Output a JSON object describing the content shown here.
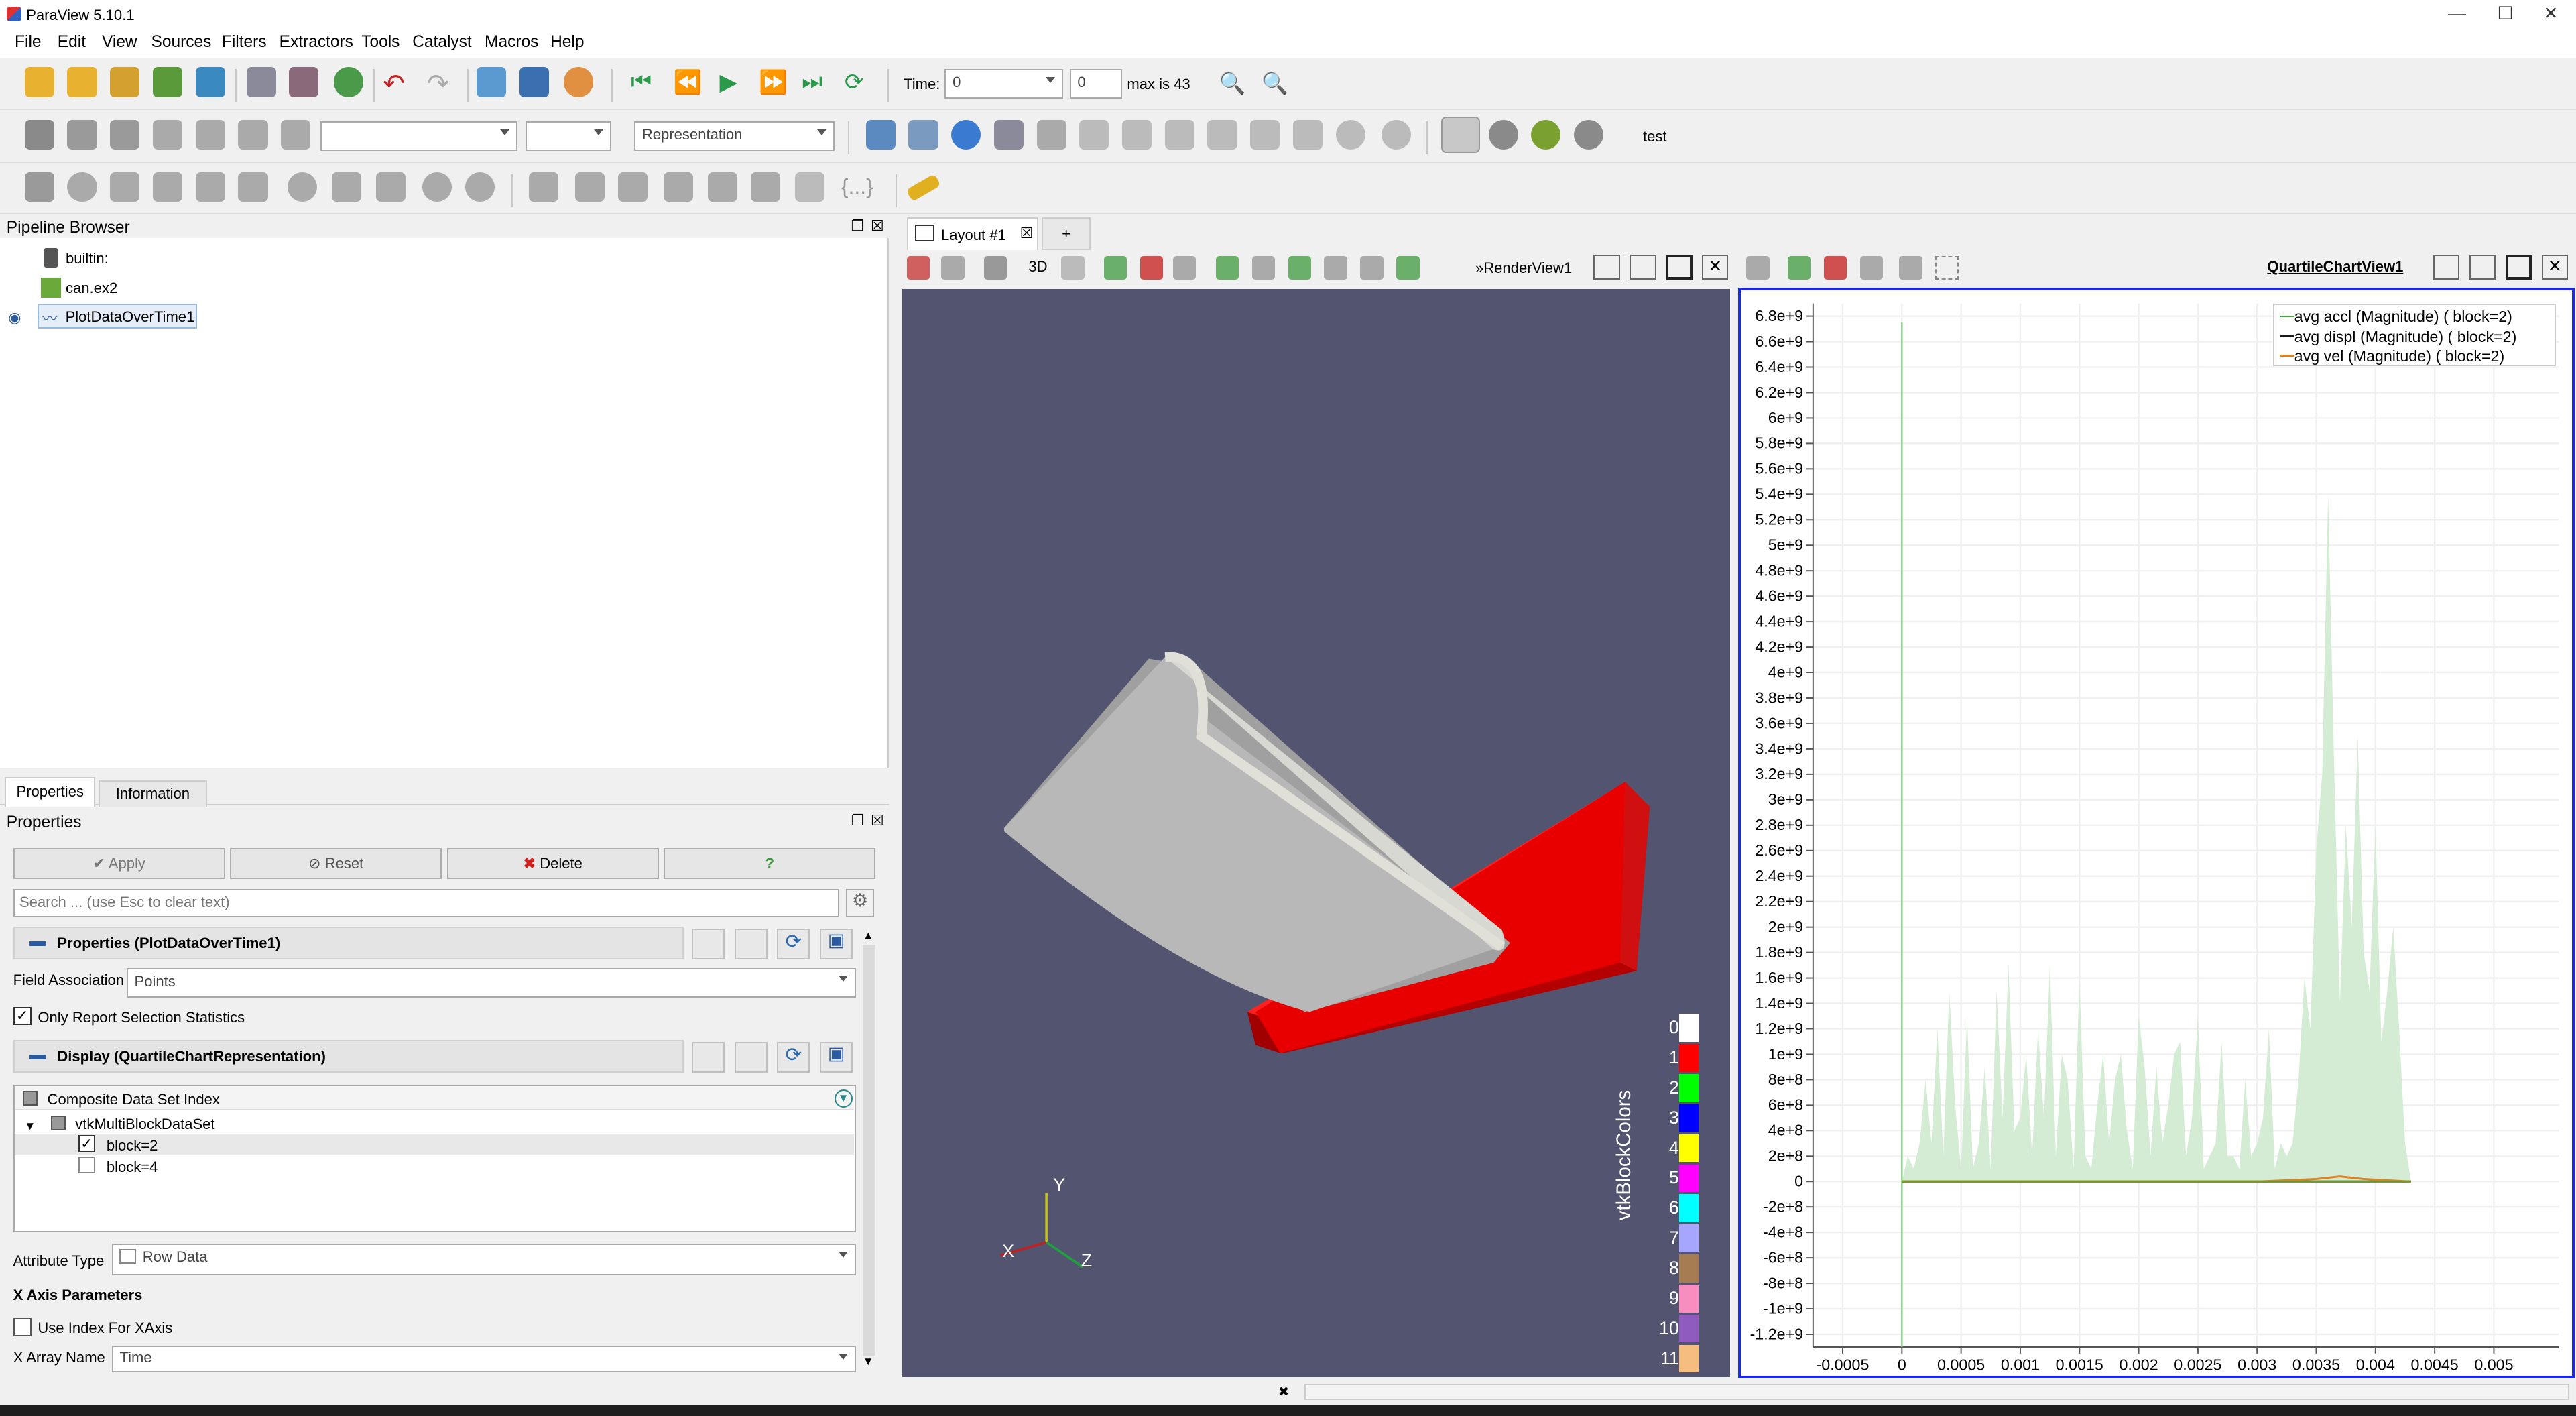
{
  "window": {
    "title": "ParaView 5.10.1",
    "minimize": "—",
    "maximize": "☐",
    "close": "✕"
  },
  "menu": [
    "File",
    "Edit",
    "View",
    "Sources",
    "Filters",
    "Extractors",
    "Tools",
    "Catalyst",
    "Macros",
    "Help"
  ],
  "time_toolbar": {
    "time_label": "Time:",
    "time_value": "0",
    "step_value": "0",
    "max_label": "max is 43"
  },
  "toolbar2": {
    "representation": "Representation",
    "camera_text": "test"
  },
  "pipeline": {
    "title": "Pipeline Browser",
    "items": [
      {
        "label": "builtin:",
        "icon": "server-icon"
      },
      {
        "label": "can.ex2",
        "icon": "dataset-icon"
      },
      {
        "label": "PlotDataOverTime1",
        "icon": "line-chart-icon"
      }
    ]
  },
  "tabs": {
    "properties": "Properties",
    "information": "Information"
  },
  "properties": {
    "title": "Properties",
    "apply": "Apply",
    "reset": "Reset",
    "delete": "Delete",
    "help": "?",
    "search_placeholder": "Search ... (use Esc to clear text)",
    "section1": "Properties (PlotDataOverTime1)",
    "field_assoc_label": "Field Association",
    "field_assoc_value": "Points",
    "only_stats_label": "Only Report Selection Statistics",
    "section2": "Display (QuartileChartRepresentation)",
    "tree_header": "Composite Data Set Index",
    "tree_root": "vtkMultiBlockDataSet",
    "blocks": [
      {
        "label": "block=2",
        "checked": true
      },
      {
        "label": "block=4",
        "checked": false
      }
    ],
    "attr_type_label": "Attribute Type",
    "attr_type_value": "Row Data",
    "x_axis_params": "X Axis Parameters",
    "use_index_label": "Use Index For XAxis",
    "x_array_label": "X Array Name",
    "x_array_value": "Time"
  },
  "layout": {
    "tab_label": "Layout #1",
    "add_tab": "+"
  },
  "render_view": {
    "label": "RenderView1",
    "btn_3d": "3D",
    "legend_title": "vtkBlockColors",
    "legend": [
      {
        "label": "0",
        "color": "#ffffff"
      },
      {
        "label": "1",
        "color": "#ff0000"
      },
      {
        "label": "2",
        "color": "#00ff00"
      },
      {
        "label": "3",
        "color": "#0000ff"
      },
      {
        "label": "4",
        "color": "#ffff00"
      },
      {
        "label": "5",
        "color": "#ff00ff"
      },
      {
        "label": "6",
        "color": "#00ffff"
      },
      {
        "label": "7",
        "color": "#a6a6ff"
      },
      {
        "label": "8",
        "color": "#a67c52"
      },
      {
        "label": "9",
        "color": "#f78ebf"
      },
      {
        "label": "10",
        "color": "#8f5bbf"
      },
      {
        "label": "11",
        "color": "#f5be7f"
      }
    ],
    "axes": {
      "x": "X",
      "y": "Y",
      "z": "Z"
    }
  },
  "chart_view": {
    "label": "QuartileChartView1"
  },
  "chart_data": {
    "type": "area",
    "x_ticks": [
      "-0.0005",
      "0",
      "0.0005",
      "0.001",
      "0.0015",
      "0.002",
      "0.0025",
      "0.003",
      "0.0035",
      "0.004",
      "0.0045",
      "0.005"
    ],
    "y_ticks": [
      "6.8e+9",
      "6.6e+9",
      "6.4e+9",
      "6.2e+9",
      "6e+9",
      "5.8e+9",
      "5.6e+9",
      "5.4e+9",
      "5.2e+9",
      "5e+9",
      "4.8e+9",
      "4.6e+9",
      "4.4e+9",
      "4.2e+9",
      "4e+9",
      "3.8e+9",
      "3.6e+9",
      "3.4e+9",
      "3.2e+9",
      "3e+9",
      "2.8e+9",
      "2.6e+9",
      "2.4e+9",
      "2.2e+9",
      "2e+9",
      "1.8e+9",
      "1.6e+9",
      "1.4e+9",
      "1.2e+9",
      "1e+9",
      "8e+8",
      "6e+8",
      "4e+8",
      "2e+8",
      "0",
      "-2e+8",
      "-4e+8",
      "-6e+8",
      "-8e+8",
      "-1e+9",
      "-1.2e+9"
    ],
    "xlim": [
      -0.00075,
      0.00555
    ],
    "ylim": [
      -1300000000.0,
      6900000000.0
    ],
    "legend_position": "top-right",
    "series": [
      {
        "name": "avg accl (Magnitude) ( block=2)",
        "color": "#3aaa3a",
        "x": [
          0,
          5e-05,
          0.0001,
          0.00015,
          0.0002,
          0.00025,
          0.0003,
          0.00035,
          0.0004,
          0.00045,
          0.0005,
          0.00055,
          0.0006,
          0.00065,
          0.0007,
          0.00075,
          0.0008,
          0.00085,
          0.0009,
          0.00095,
          0.001,
          0.00105,
          0.0011,
          0.00115,
          0.0012,
          0.00125,
          0.0013,
          0.00135,
          0.0014,
          0.00145,
          0.0015,
          0.00155,
          0.0016,
          0.00165,
          0.0017,
          0.00175,
          0.0018,
          0.00185,
          0.0019,
          0.00195,
          0.002,
          0.00205,
          0.0021,
          0.00215,
          0.0022,
          0.00225,
          0.0023,
          0.00235,
          0.0024,
          0.00245,
          0.0025,
          0.00255,
          0.0026,
          0.00265,
          0.0027,
          0.00275,
          0.0028,
          0.00285,
          0.0029,
          0.00295,
          0.003,
          0.00305,
          0.0031,
          0.00315,
          0.0032,
          0.00325,
          0.0033,
          0.00335,
          0.0034,
          0.00345,
          0.0035,
          0.00355,
          0.0036,
          0.00365,
          0.0037,
          0.00375,
          0.0038,
          0.00385,
          0.0039,
          0.00395,
          0.004,
          0.00405,
          0.0041,
          0.00415,
          0.0042,
          0.00425,
          0.0043
        ],
        "y": [
          0,
          200000000.0,
          100000000.0,
          300000000.0,
          800000000.0,
          300000000.0,
          1200000000.0,
          200000000.0,
          1500000000.0,
          600000000.0,
          90000000.0,
          1300000000.0,
          100000000.0,
          300000000.0,
          900000000.0,
          100000000.0,
          1500000000.0,
          500000000.0,
          1700000000.0,
          400000000.0,
          500000000.0,
          1000000000.0,
          200000000.0,
          1200000000.0,
          500000000.0,
          1700000000.0,
          200000000.0,
          1000000000.0,
          800000000.0,
          100000000.0,
          1600000000.0,
          200000000.0,
          100000000.0,
          600000000.0,
          1000000000.0,
          300000000.0,
          800000000.0,
          1000000000.0,
          400000000.0,
          100000000.0,
          1300000000.0,
          900000000.0,
          200000000.0,
          900000000.0,
          300000000.0,
          600000000.0,
          1000000000.0,
          1100000000.0,
          200000000.0,
          500000000.0,
          1300000000.0,
          100000000.0,
          200000000.0,
          300000000.0,
          1100000000.0,
          200000000.0,
          200000000.0,
          100000000.0,
          800000000.0,
          200000000.0,
          300000000.0,
          500000000.0,
          1200000000.0,
          100000000.0,
          300000000.0,
          200000000.0,
          300000000.0,
          800000000.0,
          1600000000.0,
          1200000000.0,
          2600000000.0,
          3200000000.0,
          5400000000.0,
          3300000000.0,
          1400000000.0,
          2800000000.0,
          2000000000.0,
          3500000000.0,
          1800000000.0,
          1500000000.0,
          2800000000.0,
          1100000000.0,
          1500000000.0,
          2000000000.0,
          1200000000.0,
          300000000.0,
          0
        ]
      },
      {
        "name": "avg displ (Magnitude) ( block=2)",
        "color": "#1a1a1a",
        "x": [
          0,
          0.0043
        ],
        "y": [
          0,
          0
        ]
      },
      {
        "name": "avg vel (Magnitude) ( block=2)",
        "color": "#e08020",
        "x": [
          0,
          0.001,
          0.002,
          0.003,
          0.0035,
          0.0037,
          0.0039,
          0.0043
        ],
        "y": [
          0,
          0,
          0,
          0,
          20000000.0,
          40000000.0,
          20000000.0,
          0
        ]
      }
    ]
  }
}
